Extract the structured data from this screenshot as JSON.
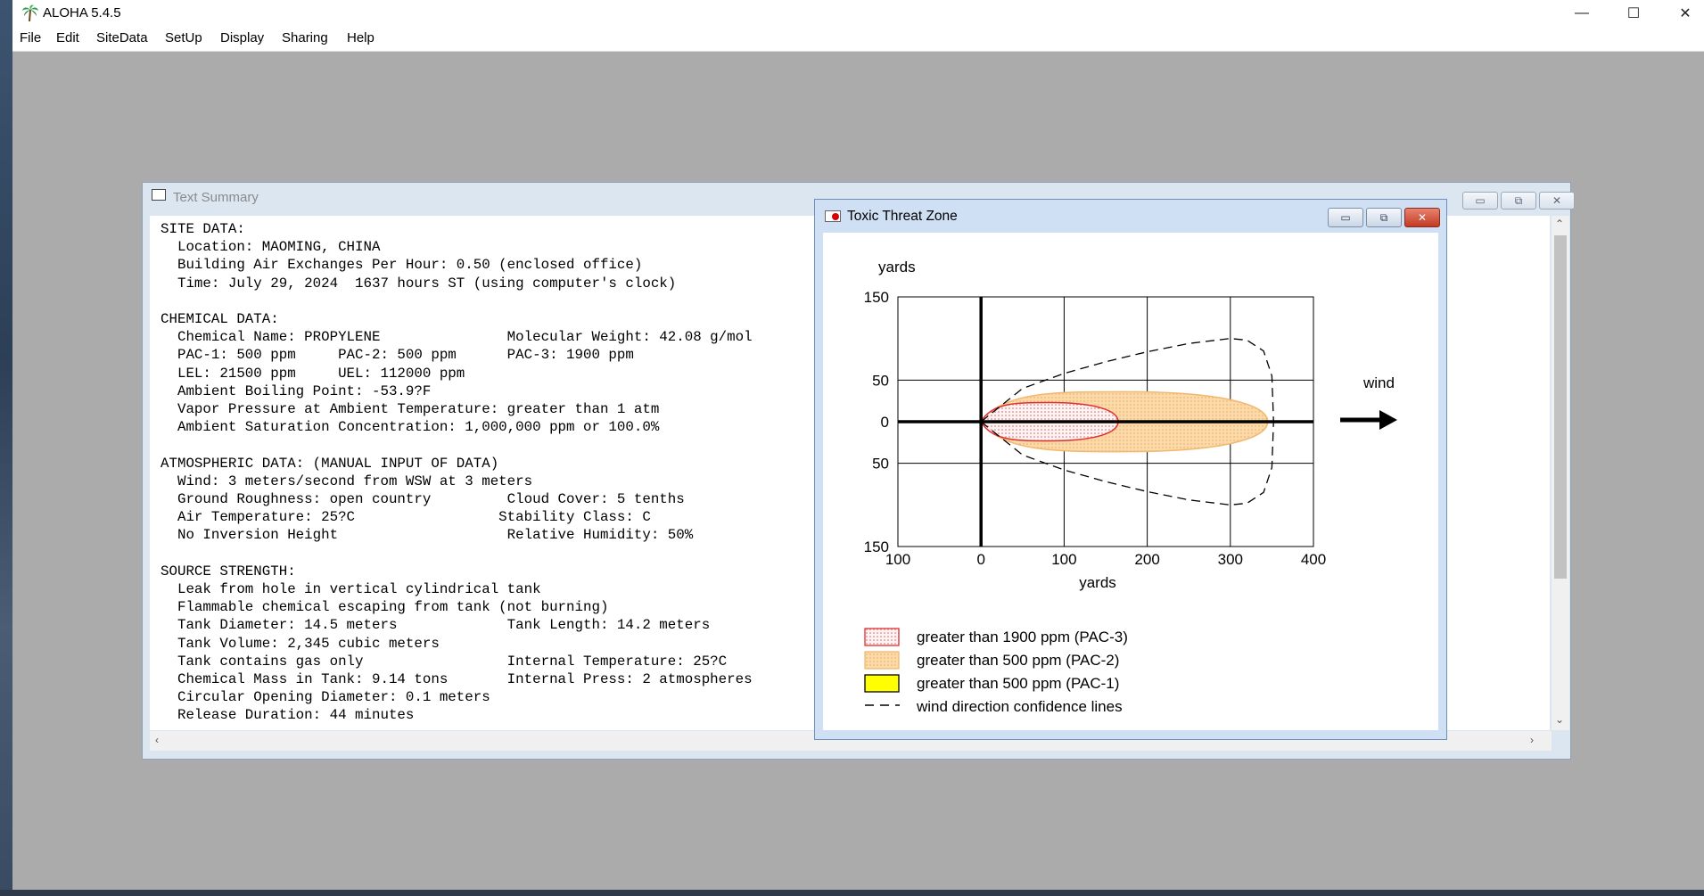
{
  "app": {
    "title": "ALOHA 5.4.5"
  },
  "menu": [
    "File",
    "Edit",
    "SiteData",
    "SetUp",
    "Display",
    "Sharing",
    "Help"
  ],
  "window_controls": {
    "minimize": "—",
    "maximize": "☐",
    "close": "✕"
  },
  "text_summary": {
    "title": "Text Summary",
    "lines": [
      "SITE DATA:",
      "  Location: MAOMING, CHINA",
      "  Building Air Exchanges Per Hour: 0.50 (enclosed office)",
      "  Time: July 29, 2024  1637 hours ST (using computer's clock)",
      "",
      "CHEMICAL DATA:",
      "  Chemical Name: PROPYLENE               Molecular Weight: 42.08 g/mol",
      "  PAC-1: 500 ppm     PAC-2: 500 ppm      PAC-3: 1900 ppm",
      "  LEL: 21500 ppm     UEL: 112000 ppm",
      "  Ambient Boiling Point: -53.9?F",
      "  Vapor Pressure at Ambient Temperature: greater than 1 atm",
      "  Ambient Saturation Concentration: 1,000,000 ppm or 100.0%",
      "",
      "ATMOSPHERIC DATA: (MANUAL INPUT OF DATA)",
      "  Wind: 3 meters/second from WSW at 3 meters",
      "  Ground Roughness: open country         Cloud Cover: 5 tenths",
      "  Air Temperature: 25?C                 Stability Class: C",
      "  No Inversion Height                    Relative Humidity: 50%",
      "",
      "SOURCE STRENGTH:",
      "  Leak from hole in vertical cylindrical tank",
      "  Flammable chemical escaping from tank (not burning)",
      "  Tank Diameter: 14.5 meters             Tank Length: 14.2 meters",
      "  Tank Volume: 2,345 cubic meters",
      "  Tank contains gas only                 Internal Temperature: 25?C",
      "  Chemical Mass in Tank: 9.14 tons       Internal Press: 2 atmospheres",
      "  Circular Opening Diameter: 0.1 meters",
      "  Release Duration: 44 minutes"
    ]
  },
  "threat_zone": {
    "title": "Toxic Threat Zone",
    "wind_label": "wind",
    "legend": [
      {
        "label": "greater than 1900 ppm (PAC-3)",
        "swatch": "pac3",
        "color": "#e03030"
      },
      {
        "label": "greater than 500 ppm (PAC-2)",
        "swatch": "pac2",
        "color": "#f5c88a"
      },
      {
        "label": "greater than 500 ppm (PAC-1)",
        "swatch": "pac1",
        "color": "#ffff00"
      },
      {
        "label": "wind direction confidence lines",
        "swatch": "dash",
        "color": "#000000"
      }
    ]
  },
  "chart_data": {
    "type": "area",
    "xlabel": "yards",
    "ylabel": "yards",
    "xlim": [
      -100,
      400
    ],
    "ylim": [
      -150,
      150
    ],
    "x_ticks": [
      "100",
      "0",
      "100",
      "200",
      "300",
      "400"
    ],
    "y_ticks": [
      "150",
      "50",
      "0",
      "50",
      "150"
    ],
    "x_tick_values": [
      -100,
      0,
      100,
      200,
      300,
      400
    ],
    "y_tick_values": [
      150,
      50,
      0,
      -50,
      -150
    ],
    "grid": true,
    "zones": [
      {
        "name": "greater than 1900 ppm (PAC-3)",
        "x_start": 0,
        "x_end": 165,
        "half_width": 23
      },
      {
        "name": "greater than 500 ppm (PAC-2)",
        "x_start": 0,
        "x_end": 345,
        "half_width": 36
      },
      {
        "name": "greater than 500 ppm (PAC-1)",
        "x_start": 0,
        "x_end": 345,
        "half_width": 36
      }
    ],
    "confidence_lines": {
      "upper": [
        [
          0,
          0
        ],
        [
          50,
          40
        ],
        [
          100,
          58
        ],
        [
          150,
          72
        ],
        [
          200,
          84
        ],
        [
          250,
          94
        ],
        [
          300,
          100
        ],
        [
          320,
          98
        ],
        [
          340,
          85
        ],
        [
          350,
          55
        ],
        [
          352,
          0
        ]
      ],
      "lower": [
        [
          0,
          0
        ],
        [
          50,
          -40
        ],
        [
          100,
          -58
        ],
        [
          150,
          -72
        ],
        [
          200,
          -84
        ],
        [
          250,
          -94
        ],
        [
          300,
          -100
        ],
        [
          320,
          -98
        ],
        [
          340,
          -85
        ],
        [
          350,
          -55
        ],
        [
          352,
          0
        ]
      ]
    }
  }
}
